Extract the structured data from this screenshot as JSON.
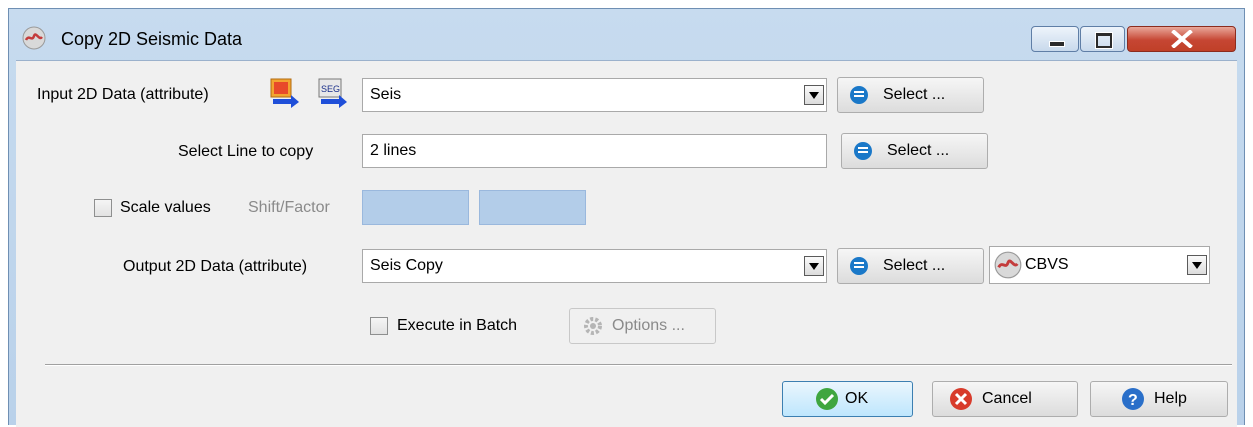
{
  "window": {
    "title": "Copy 2D Seismic Data",
    "accent": "#b9d1ea",
    "close_color": "#c64633"
  },
  "input": {
    "label": "Input 2D Data (attribute)",
    "value": "Seis",
    "select_label": "Select ..."
  },
  "line": {
    "label": "Select Line to copy",
    "value": "2 lines",
    "select_label": "Select ..."
  },
  "scale": {
    "checkbox_label": "Scale values",
    "field_label": "Shift/Factor",
    "checked": false
  },
  "output": {
    "label": "Output 2D Data (attribute)",
    "value": "Seis Copy",
    "select_label": "Select ...",
    "format": "CBVS"
  },
  "batch": {
    "checkbox_label": "Execute in Batch",
    "options_label": "Options ...",
    "checked": false
  },
  "buttons": {
    "ok": "OK",
    "cancel": "Cancel",
    "help": "Help"
  }
}
